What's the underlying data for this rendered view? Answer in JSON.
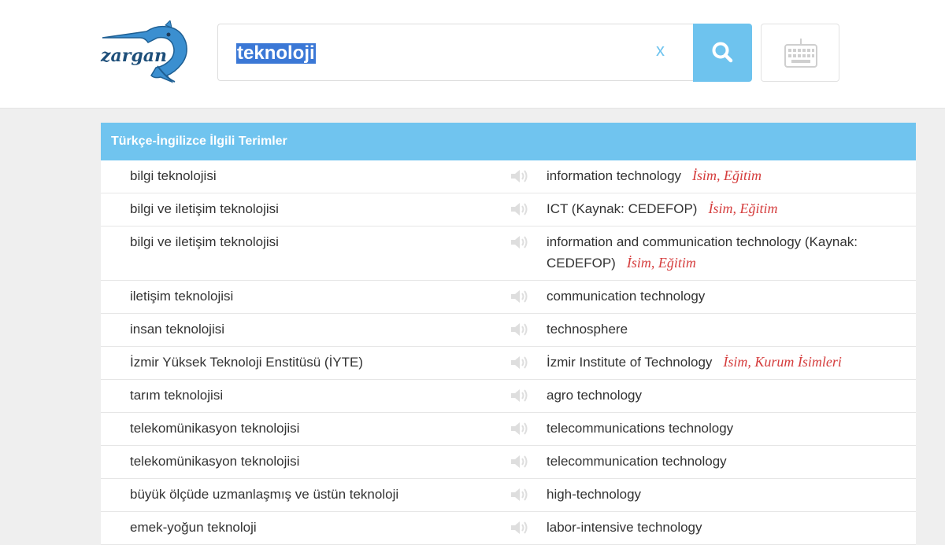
{
  "search": {
    "value": "teknoloji",
    "clear_label": "x"
  },
  "logo": {
    "text": "zargan"
  },
  "icons": {
    "search": "search-icon",
    "keyboard": "keyboard-icon",
    "speaker": "speaker-icon"
  },
  "colors": {
    "accent": "#70c4ef",
    "tag": "#d53d3d",
    "selection": "#3b78d6"
  },
  "results": {
    "title": "Türkçe-İngilizce İlgili Terimler",
    "rows": [
      {
        "tr": "bilgi teknolojisi",
        "en": "information technology",
        "tag": "İsim, Eğitim"
      },
      {
        "tr": "bilgi ve iletişim teknolojisi",
        "en": "ICT (Kaynak: CEDEFOP)",
        "tag": "İsim, Eğitim"
      },
      {
        "tr": "bilgi ve iletişim teknolojisi",
        "en": "information and communication technology (Kaynak: CEDEFOP)",
        "tag": "İsim, Eğitim"
      },
      {
        "tr": "iletişim teknolojisi",
        "en": "communication technology",
        "tag": ""
      },
      {
        "tr": "insan teknolojisi",
        "en": "technosphere",
        "tag": ""
      },
      {
        "tr": "İzmir Yüksek Teknoloji Enstitüsü (İYTE)",
        "en": "İzmir Institute of Technology",
        "tag": "İsim, Kurum İsimleri"
      },
      {
        "tr": "tarım teknolojisi",
        "en": "agro technology",
        "tag": ""
      },
      {
        "tr": "telekomünikasyon teknolojisi",
        "en": "telecommunications technology",
        "tag": ""
      },
      {
        "tr": "telekomünikasyon teknolojisi",
        "en": "telecommunication technology",
        "tag": ""
      },
      {
        "tr": "büyük ölçüde uzmanlaşmış ve üstün teknoloji",
        "en": "high-technology",
        "tag": ""
      },
      {
        "tr": "emek-yoğun teknoloji",
        "en": "labor-intensive technology",
        "tag": ""
      }
    ]
  }
}
